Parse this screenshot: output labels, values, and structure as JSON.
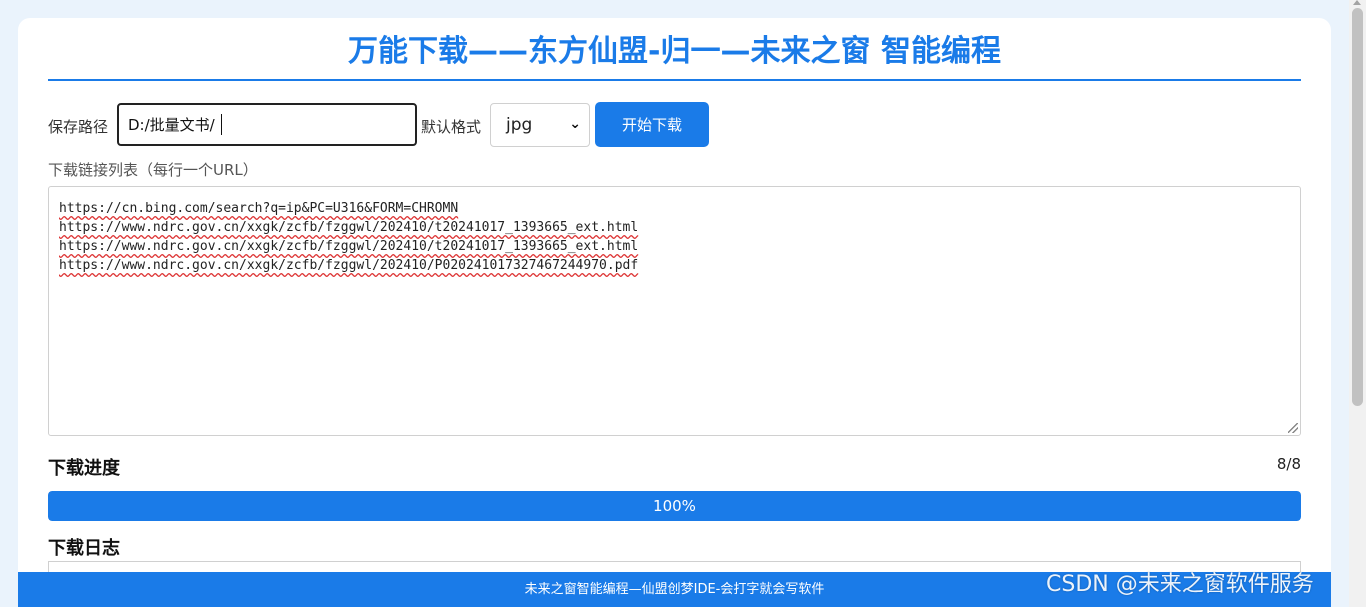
{
  "header": {
    "title": "万能下载——东方仙盟-归一—未来之窗 智能编程"
  },
  "form": {
    "save_path_label": "保存路径",
    "save_path_value": "D:/批量文书/",
    "default_format_label": "默认格式",
    "format_selected": "jpg",
    "start_button_label": "开始下载"
  },
  "url_list": {
    "label": "下载链接列表（每行一个URL）",
    "lines": [
      "https://cn.bing.com/search?q=ip&PC=U316&FORM=CHROMN",
      "https://www.ndrc.gov.cn/xxgk/zcfb/fzggwl/202410/t20241017_1393665_ext.html",
      "https://www.ndrc.gov.cn/xxgk/zcfb/fzggwl/202410/t20241017_1393665_ext.html",
      "https://www.ndrc.gov.cn/xxgk/zcfb/fzggwl/202410/P020241017327467244970.pdf"
    ]
  },
  "progress": {
    "heading": "下载进度",
    "count": "8/8",
    "percent_text": "100%",
    "fraction": 1.0
  },
  "log": {
    "heading": "下载日志"
  },
  "footer": {
    "text": "未来之窗智能编程—仙盟创梦IDE-会打字就会写软件"
  },
  "watermark": {
    "text": "CSDN @未来之窗软件服务"
  },
  "icons": {
    "select_chevron": "chevron-down-icon",
    "resize_grip": "resize-grip-icon"
  },
  "colors": {
    "accent": "#1a7be8",
    "background": "#eaf3fc"
  }
}
